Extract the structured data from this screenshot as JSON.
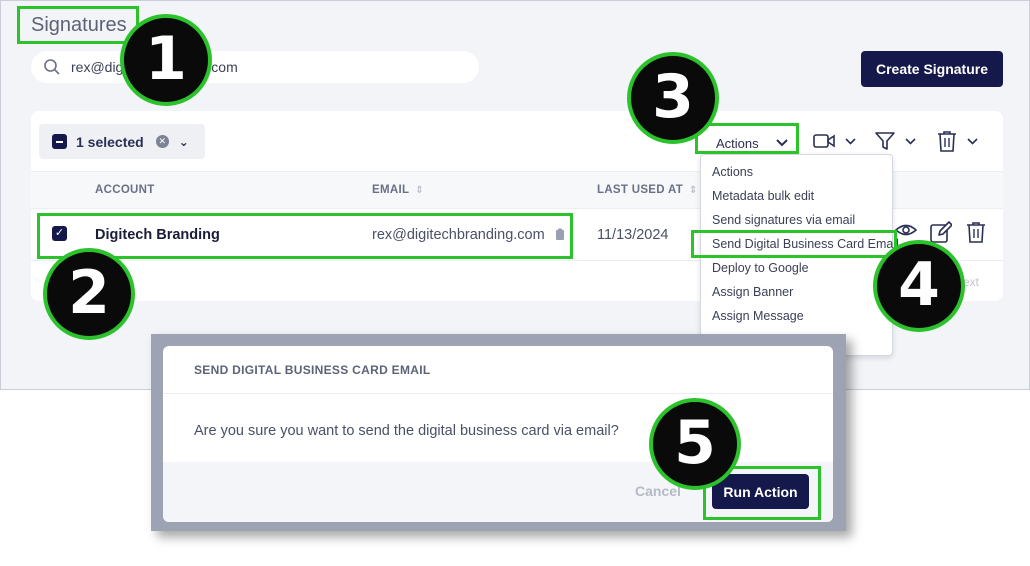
{
  "page": {
    "title": "Signatures",
    "search_value": "rex@digitechbranding.com",
    "create_button": "Create Signature"
  },
  "toolbar": {
    "selected_label": "1 selected",
    "actions_label": "Actions"
  },
  "table": {
    "columns": [
      "ACCOUNT",
      "EMAIL",
      "LAST USED AT"
    ],
    "rows": [
      {
        "account": "Digitech Branding",
        "email": "rex@digitechbranding.com",
        "last_used": "11/13/2024"
      }
    ],
    "pagination_next": "ext"
  },
  "actions_menu": {
    "items": [
      "Actions",
      "Metadata bulk edit",
      "Send signatures via email",
      "Send Digital Business Card Email",
      "Deploy to Google",
      "Assign Banner",
      "Assign Message"
    ]
  },
  "modal": {
    "title": "SEND DIGITAL BUSINESS CARD EMAIL",
    "message": "Are you sure you want to send the digital business card via email?",
    "cancel": "Cancel",
    "confirm": "Run Action"
  },
  "callouts": [
    "1",
    "2",
    "3",
    "4",
    "5"
  ],
  "colors": {
    "highlight": "#2bc22b",
    "primary": "#15184a"
  }
}
